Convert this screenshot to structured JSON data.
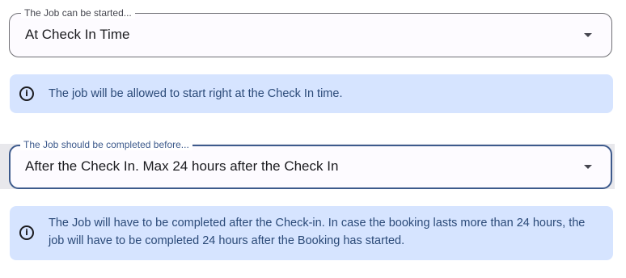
{
  "start_select": {
    "label": "The Job can be started...",
    "value": "At Check In Time"
  },
  "start_info": {
    "icon": "info-icon",
    "text": "The job will be allowed to start right at the Check In time."
  },
  "complete_select": {
    "label": "The Job should be completed before...",
    "value": "After the Check In. Max 24 hours after the Check In"
  },
  "complete_info": {
    "icon": "info-icon",
    "text": "The Job will have to be completed after the Check-in. In case the booking lasts more than 24 hours, the job will have to be completed 24 hours after the Booking has started."
  },
  "colors": {
    "info_background": "#d6e4ff",
    "info_text": "#2b4a78",
    "focused_border": "#3d5a8c"
  }
}
